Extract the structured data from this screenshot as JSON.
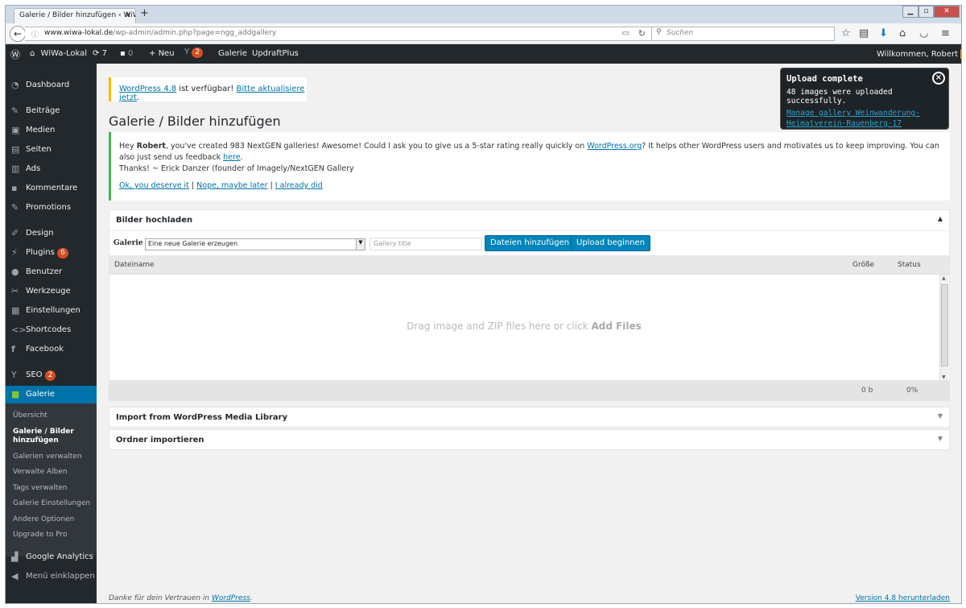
{
  "browser": {
    "tab_title": "Galerie / Bilder hinzufügen ‹ WiW",
    "url_host": "www.wiwa-lokal.de",
    "url_path": "/wp-admin/admin.php?page=ngg_addgallery",
    "search_placeholder": "Suchen"
  },
  "adminbar": {
    "site_name": "WiWa-Lokal",
    "updates": "7",
    "comments": "0",
    "new": "Neu",
    "seo_badge": "2",
    "galerie": "Galerie",
    "updraft": "UpdraftPlus",
    "welcome": "Willkommen, Robert"
  },
  "sidebar": {
    "items": [
      {
        "label": "Dashboard",
        "icon": "dashboard-icon"
      },
      {
        "label": "Beiträge",
        "icon": "pin-icon"
      },
      {
        "label": "Medien",
        "icon": "media-icon"
      },
      {
        "label": "Seiten",
        "icon": "page-icon"
      },
      {
        "label": "Ads",
        "icon": "ads-icon"
      },
      {
        "label": "Kommentare",
        "icon": "comment-icon"
      },
      {
        "label": "Promotions",
        "icon": "pin-icon"
      },
      {
        "label": "Design",
        "icon": "brush-icon"
      },
      {
        "label": "Plugins",
        "icon": "plugin-icon",
        "badge": "6"
      },
      {
        "label": "Benutzer",
        "icon": "user-icon"
      },
      {
        "label": "Werkzeuge",
        "icon": "wrench-icon"
      },
      {
        "label": "Einstellungen",
        "icon": "settings-icon"
      },
      {
        "label": "Shortcodes",
        "icon": "code-icon"
      },
      {
        "label": "Facebook",
        "icon": "facebook-icon"
      },
      {
        "label": "SEO",
        "icon": "yoast-icon",
        "badge": "2"
      },
      {
        "label": "Galerie",
        "icon": "gallery-icon"
      }
    ],
    "submenu": [
      "Übersicht",
      "Galerie / Bilder hinzufügen",
      "Galerien verwalten",
      "Verwalte Alben",
      "Tags verwalten",
      "Galerie Einstellungen",
      "Andere Optionen",
      "Upgrade to Pro"
    ],
    "after": [
      {
        "label": "Google Analytics",
        "icon": "analytics-icon"
      },
      {
        "label": "Menü einklappen",
        "icon": "collapse-icon"
      }
    ]
  },
  "notice": {
    "link1": "WordPress 4.8",
    "text": " ist verfügbar! ",
    "link2": "Bitte aktualisiere jetzt",
    "end": "."
  },
  "page_title": "Galerie / Bilder hinzufügen",
  "rating": {
    "pre": "Hey ",
    "name": "Robert",
    "mid": ", you've created 983 NextGEN galleries! Awesome! Could I ask you to give us a 5-star rating really quickly on ",
    "link_wp": "WordPress.org",
    "post": "? It helps other WordPress users and motivates us to keep improving. You can also just send us feedback ",
    "link_here": "here",
    "dot": ".",
    "line2": "Thanks! ~ Erick Danzer (founder of Imagely/NextGEN Gallery",
    "opt1": "Ok, you deserve it",
    "opt2": "Nope, maybe later",
    "opt3": "I already did",
    "sep": " | "
  },
  "upload": {
    "header": "Bilder hochladen",
    "toggle": "▲",
    "galerie_label": "Galerie",
    "select_value": "Eine neue Galerie erzeugen",
    "title_placeholder": "Gallery title",
    "add_files": "Dateien hinzufügen",
    "start_upload": "Upload beginnen",
    "col_name": "Dateiname",
    "col_size": "Größe",
    "col_status": "Status",
    "drop_text": "Drag image and ZIP files here or click ",
    "drop_bold": "Add Files",
    "total_size": "0 b",
    "total_pct": "0%"
  },
  "import_panel": {
    "header": "Import from WordPress Media Library",
    "toggle": "▼"
  },
  "folder_panel": {
    "header": "Ordner importieren",
    "toggle": "▼"
  },
  "footer": {
    "thanks": "Danke für dein Vertrauen in ",
    "wp": "WordPress",
    "dot": ".",
    "version": "Version 4.8 herunterladen"
  },
  "toast": {
    "title": "Upload complete",
    "message": "48 images were uploaded successfully.",
    "link": "Manage gallery Weinwanderung-Heimatverein-Rauenberg-17",
    "close": "×"
  }
}
